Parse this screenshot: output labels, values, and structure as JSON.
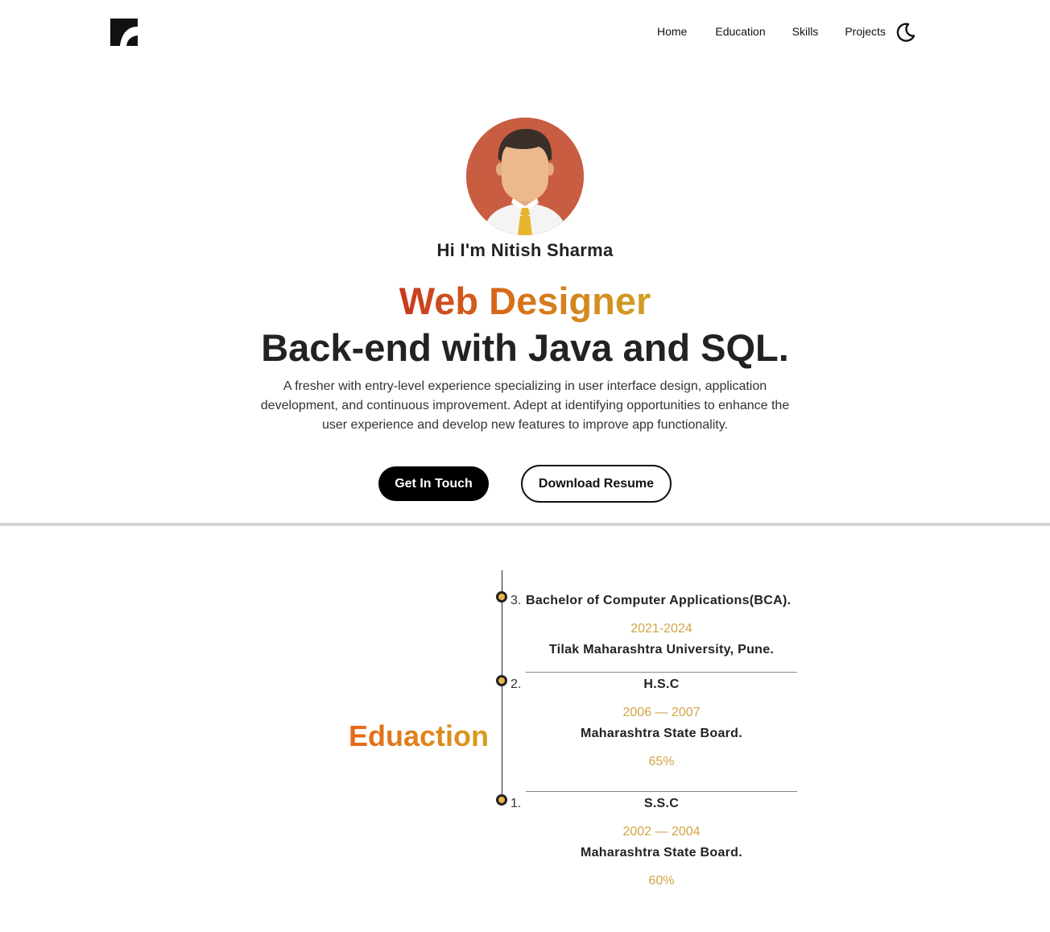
{
  "nav": {
    "items": [
      "Home",
      "Education",
      "Skills",
      "Projects"
    ]
  },
  "hero": {
    "greeting": "Hi I'm Nitish Sharma",
    "role": "Web Designer",
    "tagline": "Back-end with Java and SQL.",
    "description": "A fresher with entry-level experience specializing in user interface design, application development, and continuous improvement. Adept at identifying opportunities to enhance the user experience and develop new features to improve app functionality.",
    "cta_primary": "Get In Touch",
    "cta_secondary": "Download Resume"
  },
  "education": {
    "title": "Eduaction",
    "entries": [
      {
        "number": "3.",
        "title": "Bachelor of Computer Applications(BCA).",
        "years": "2021-2024",
        "institution": "Tilak Maharashtra University, Pune."
      },
      {
        "number": "2.",
        "title": "H.S.C",
        "years": "2006 — 2007",
        "institution": "Maharashtra State Board.",
        "score": "65%"
      },
      {
        "number": "1.",
        "title": "S.S.C",
        "years": "2002 — 2004",
        "institution": "Maharashtra State Board.",
        "score": "60%"
      }
    ]
  },
  "icons": {
    "logo": "logo-icon",
    "theme_toggle": "moon-icon",
    "avatar": "avatar-illustration"
  },
  "colors": {
    "role_gradient": [
      "#c8361f",
      "#d8701a",
      "#d1a023"
    ],
    "education_gradient": [
      "#e8651a",
      "#d69e1f"
    ],
    "year_color": "#d1a544",
    "dot_fill": "#e7b54a"
  }
}
